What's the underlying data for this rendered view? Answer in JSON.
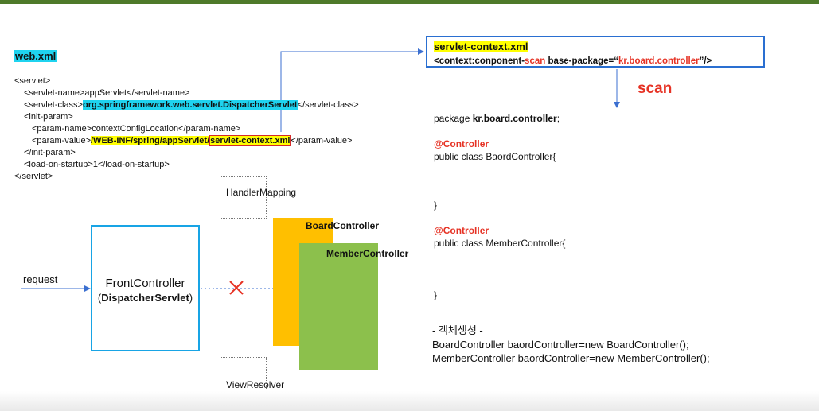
{
  "web_xml": {
    "title": "web.xml",
    "lines": {
      "servlet_open": "<servlet>",
      "servlet_name": "<servlet-name>appServlet</servlet-name>",
      "servlet_class_open": "<servlet-class>",
      "servlet_class_value": "org.springframework.web.servlet.DispatcherServlet",
      "servlet_class_close": "</servlet-class>",
      "init_param_open": "<init-param>",
      "param_name": "<param-name>contextConfigLocation</param-name>",
      "param_value_open": "<param-value>",
      "param_value_path": "/WEB-INF/spring/appServlet/",
      "param_value_file": "servlet-context.xml",
      "param_value_close": "</param-value>",
      "init_param_close": "</init-param>",
      "load_on_startup": "<load-on-startup>1</load-on-startup>",
      "servlet_close": "</servlet>"
    }
  },
  "servlet_context": {
    "title": "servlet-context.xml",
    "line_prefix": "<context:conponent-",
    "line_scan": "scan",
    "line_middle": " base-package=“",
    "line_package": "kr.board.controller",
    "line_suffix": "”/>"
  },
  "scan_label": "scan",
  "java": {
    "package_prefix": "package ",
    "package_name": "kr.board.controller",
    "package_suffix": ";",
    "annotation1": "@Controller",
    "class1": "public class BaordController{",
    "close1": "}",
    "annotation2": "@Controller",
    "class2": "public class MemberController{",
    "close2": "}",
    "object_title": "- 객체생성 -",
    "object_line1": "BoardController baordController=new BoardController();",
    "object_line2": "MemberController baordController=new MemberController();"
  },
  "diagram": {
    "handler_mapping": "HandlerMapping",
    "view_resolver": "ViewResolver",
    "request": "request",
    "front_title": "FrontController",
    "front_sub": "DispatcherServlet",
    "board_controller": "BoardController",
    "member_controller": "MemberController"
  },
  "colors": {
    "cyan_highlight": "#1fd3ef",
    "yellow_highlight": "#ffff00",
    "red": "#e63224",
    "blue_line": "#2a6fd1",
    "front_border": "#18a4e5",
    "board_fill": "#ffbf00",
    "member_fill": "#8cc04c",
    "top_bar": "#4e7a2a"
  }
}
